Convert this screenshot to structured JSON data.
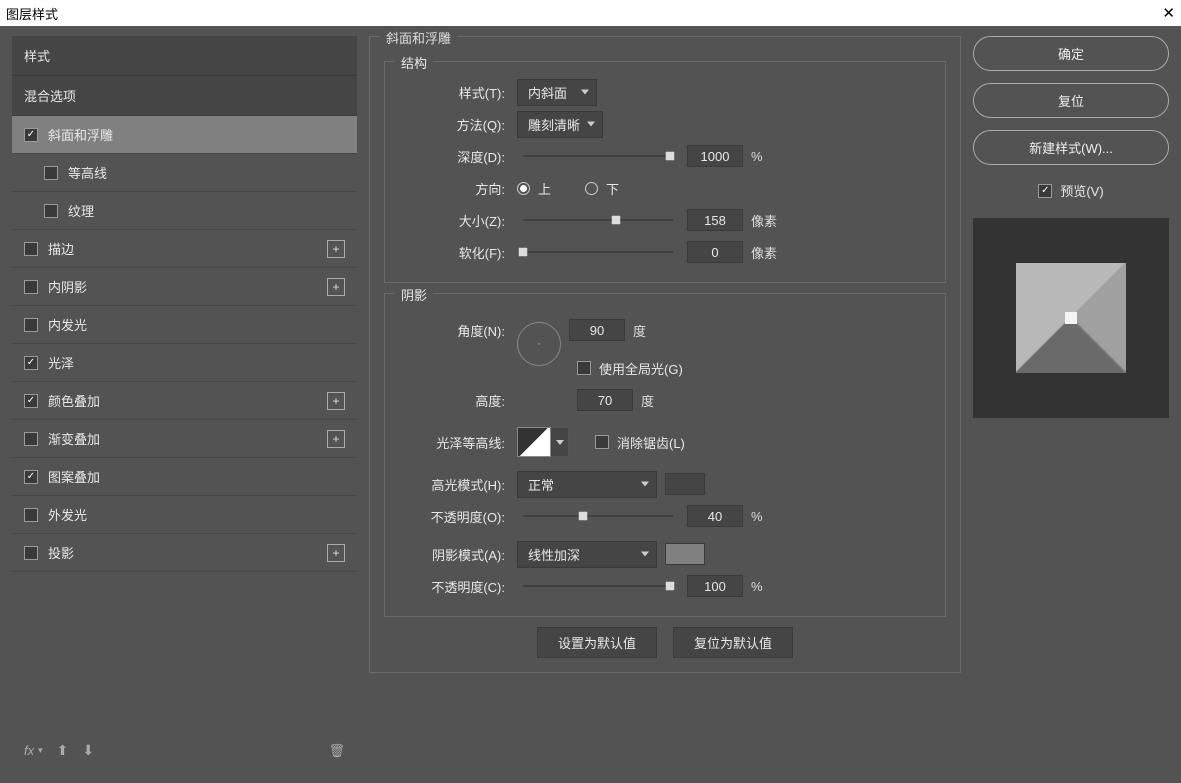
{
  "title": "图层样式",
  "sidebar": {
    "styles_label": "样式",
    "blend_options_label": "混合选项",
    "effects": [
      {
        "label": "斜面和浮雕",
        "checked": true,
        "selected": true,
        "add": false,
        "sub": false
      },
      {
        "label": "等高线",
        "checked": false,
        "selected": false,
        "add": false,
        "sub": true
      },
      {
        "label": "纹理",
        "checked": false,
        "selected": false,
        "add": false,
        "sub": true
      },
      {
        "label": "描边",
        "checked": false,
        "selected": false,
        "add": true,
        "sub": false
      },
      {
        "label": "内阴影",
        "checked": false,
        "selected": false,
        "add": true,
        "sub": false
      },
      {
        "label": "内发光",
        "checked": false,
        "selected": false,
        "add": false,
        "sub": false
      },
      {
        "label": "光泽",
        "checked": true,
        "selected": false,
        "add": false,
        "sub": false
      },
      {
        "label": "颜色叠加",
        "checked": true,
        "selected": false,
        "add": true,
        "sub": false
      },
      {
        "label": "渐变叠加",
        "checked": false,
        "selected": false,
        "add": true,
        "sub": false
      },
      {
        "label": "图案叠加",
        "checked": true,
        "selected": false,
        "add": false,
        "sub": false
      },
      {
        "label": "外发光",
        "checked": false,
        "selected": false,
        "add": false,
        "sub": false
      },
      {
        "label": "投影",
        "checked": false,
        "selected": false,
        "add": true,
        "sub": false
      }
    ],
    "fx_label": "fx"
  },
  "panel": {
    "title": "斜面和浮雕",
    "structure": {
      "legend": "结构",
      "style_label": "样式(T):",
      "style_value": "内斜面",
      "technique_label": "方法(Q):",
      "technique_value": "雕刻清晰",
      "depth_label": "深度(D):",
      "depth_value": "1000",
      "depth_unit": "%",
      "direction_label": "方向:",
      "direction_up": "上",
      "direction_down": "下",
      "size_label": "大小(Z):",
      "size_value": "158",
      "size_unit": "像素",
      "soften_label": "软化(F):",
      "soften_value": "0",
      "soften_unit": "像素"
    },
    "shading": {
      "legend": "阴影",
      "angle_label": "角度(N):",
      "angle_value": "90",
      "angle_unit": "度",
      "global_light_label": "使用全局光(G)",
      "altitude_label": "高度:",
      "altitude_value": "70",
      "altitude_unit": "度",
      "gloss_contour_label": "光泽等高线:",
      "antialias_label": "消除锯齿(L)",
      "highlight_mode_label": "高光模式(H):",
      "highlight_mode_value": "正常",
      "highlight_opacity_label": "不透明度(O):",
      "highlight_opacity_value": "40",
      "highlight_opacity_unit": "%",
      "shadow_mode_label": "阴影模式(A):",
      "shadow_mode_value": "线性加深",
      "shadow_opacity_label": "不透明度(C):",
      "shadow_opacity_value": "100",
      "shadow_opacity_unit": "%"
    },
    "make_default": "设置为默认值",
    "reset_default": "复位为默认值"
  },
  "right": {
    "ok": "确定",
    "cancel": "复位",
    "new_style": "新建样式(W)...",
    "preview_label": "预览(V)"
  }
}
